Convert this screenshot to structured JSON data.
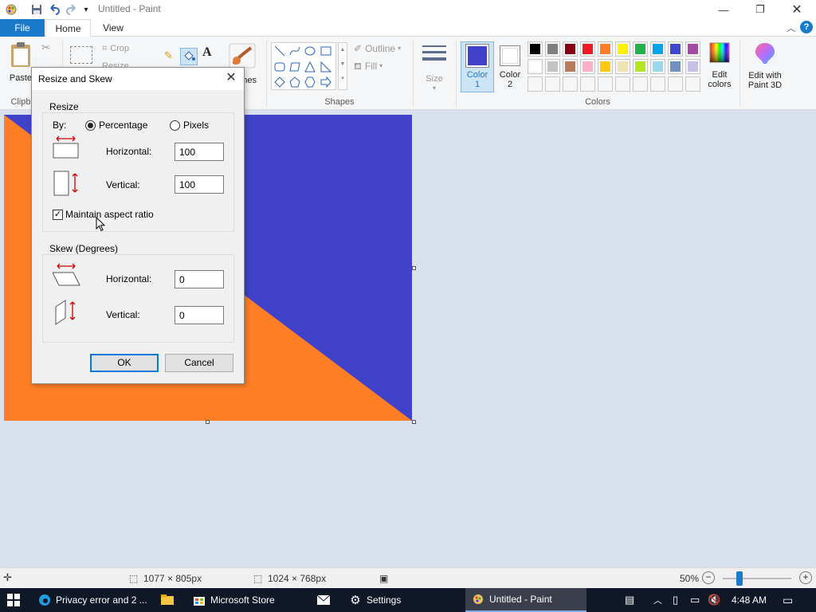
{
  "window": {
    "title": "Untitled - Paint"
  },
  "quick_access": {
    "icons": [
      "paint-app-icon",
      "save-icon",
      "undo-icon",
      "redo-icon",
      "customize-icon"
    ]
  },
  "tabs": [
    {
      "label": "File"
    },
    {
      "label": "Home"
    },
    {
      "label": "View"
    }
  ],
  "ribbon": {
    "clipboard": {
      "paste_label": "Paste",
      "group_label": "Clipb"
    },
    "image": {
      "crop_label": "Crop",
      "resize_label": "Resize"
    },
    "brushes_label": "hes",
    "shapes": {
      "outline_label": "Outline",
      "fill_label": "Fill",
      "group_label": "Shapes"
    },
    "size_label": "Size",
    "color1": {
      "line1": "Color",
      "line2": "1",
      "color": "#4042c9"
    },
    "color2": {
      "line1": "Color",
      "line2": "2",
      "color": "#ffffff"
    },
    "colors_group_label": "Colors",
    "edit_colors": {
      "line1": "Edit",
      "line2": "colors"
    },
    "edit_3d": {
      "line1": "Edit with",
      "line2": "Paint 3D"
    },
    "palette_row1": [
      "#000000",
      "#7f7f7f",
      "#880015",
      "#ed1c24",
      "#ff7f27",
      "#fff200",
      "#22b14c",
      "#00a2e8",
      "#3f48cc",
      "#a349a4"
    ],
    "palette_row2": [
      "#ffffff",
      "#c3c3c3",
      "#b97a57",
      "#ffaec9",
      "#ffc90e",
      "#efe4b0",
      "#b5e61d",
      "#99d9ea",
      "#7092be",
      "#c8bfe7"
    ]
  },
  "canvas": {
    "background": "#4042c9",
    "triangle_color": "#ff7f27"
  },
  "dialog": {
    "title": "Resize and Skew",
    "resize_legend": "Resize",
    "by_label": "By:",
    "percentage_label": "Percentage",
    "pixels_label": "Pixels",
    "horizontal_label": "Horizontal:",
    "vertical_label": "Vertical:",
    "resize_horizontal_value": "100",
    "resize_vertical_value": "100",
    "maintain_label": "Maintain aspect ratio",
    "skew_legend": "Skew (Degrees)",
    "skew_horizontal_value": "0",
    "skew_vertical_value": "0",
    "ok_label": "OK",
    "cancel_label": "Cancel"
  },
  "statusbar": {
    "selection_size": "1077 × 805px",
    "image_size": "1024 × 768px",
    "zoom": "50%"
  },
  "taskbar": {
    "items": [
      {
        "label": "Privacy error and 2 ..."
      },
      {
        "label": "Microsoft Store"
      },
      {
        "label": "Settings"
      },
      {
        "label": "Untitled - Paint"
      }
    ],
    "time": "4:48 AM"
  }
}
